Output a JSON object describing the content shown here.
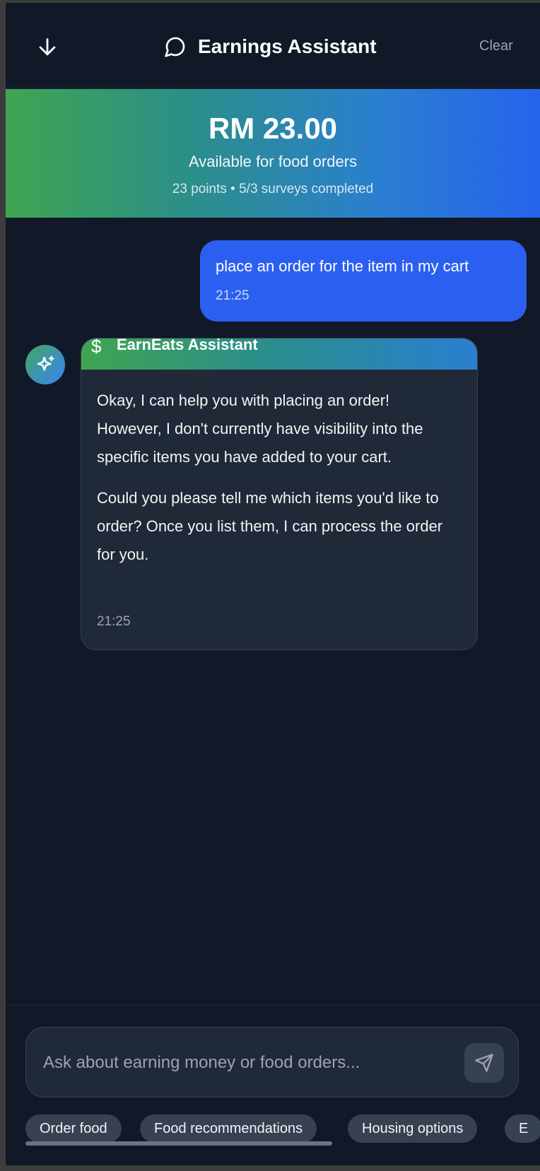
{
  "header": {
    "title": "Earnings Assistant",
    "clear_label": "Clear"
  },
  "banner": {
    "balance": "RM 23.00",
    "subtitle": "Available for food orders",
    "stats": "23 points • 5/3 surveys completed"
  },
  "messages": {
    "user": {
      "text": "place an order for the item in my cart",
      "time": "21:25"
    },
    "bot": {
      "sender": "EarnEats Assistant",
      "symbol": "$",
      "paragraph1": "Okay, I can help you with placing an order! However, I don't currently have visibility into the specific items you have added to your cart.",
      "paragraph2": "Could you please tell me which items you'd like to order? Once you list them, I can process the order for you.",
      "time": "21:25"
    }
  },
  "input": {
    "placeholder": "Ask about earning money or food orders..."
  },
  "chips": [
    "Order food",
    "Food recommendations",
    "Housing options",
    "E"
  ],
  "colors": {
    "background": "#111827",
    "card": "#1f2937",
    "user_bubble": "#2b5ff0",
    "gradient_start": "#3fa551",
    "gradient_end": "#2563eb"
  },
  "icons": [
    "arrow-down-icon",
    "chat-bubble-icon",
    "sparkles-icon",
    "dollar-icon",
    "send-icon"
  ]
}
